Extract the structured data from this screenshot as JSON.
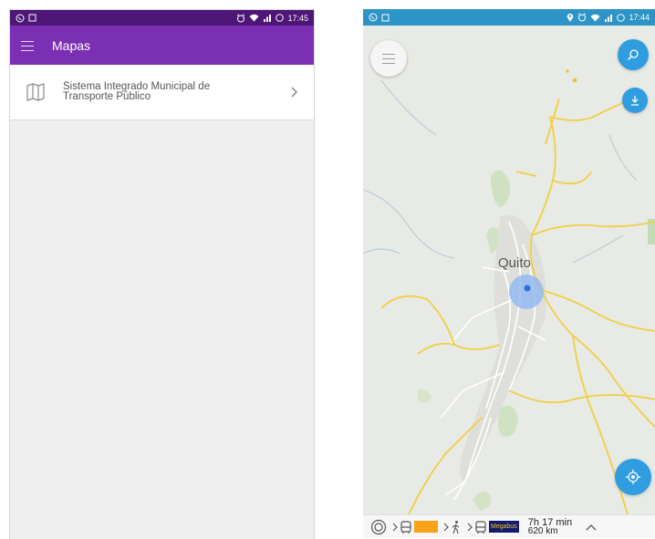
{
  "left": {
    "status_time": "17:45",
    "app_title": "Mapas",
    "list_item": {
      "line1": "Sistema Integrado Municipal de",
      "line2": "Transporte Público"
    }
  },
  "right": {
    "status_time": "17:44",
    "city_label": "Quito",
    "route_badge": "Megabus",
    "trip_time": "7h 17 min",
    "trip_distance": "620 km"
  },
  "colors": {
    "purple_status": "#4d1677",
    "purple_appbar": "#7b2fb2",
    "blue_status": "#2c94c6",
    "fab_blue": "#2f9de0",
    "route_orange": "#f7a21b",
    "road_yellow": "#f3d24b"
  },
  "icons": [
    "whatsapp-icon",
    "notification-square-icon",
    "alarm-icon",
    "wifi-icon",
    "signal-icon",
    "location-pin-icon",
    "hamburger-menu-icon",
    "map-icon",
    "chevron-right-icon",
    "search-icon",
    "download-icon",
    "my-location-icon",
    "origin-icon",
    "bus-icon",
    "walk-icon",
    "chevron-up-icon"
  ]
}
